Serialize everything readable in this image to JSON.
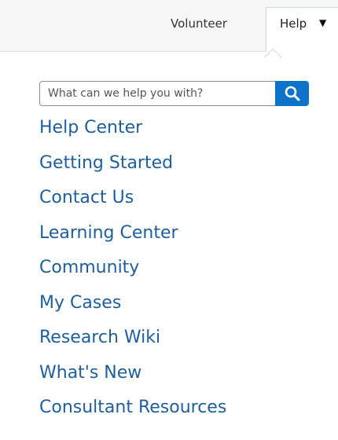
{
  "topnav": {
    "volunteer_label": "Volunteer",
    "help_label": "Help",
    "help_caret": "▼"
  },
  "search": {
    "placeholder": "What can we help you with?",
    "button_icon": "search-icon"
  },
  "menu": {
    "items": [
      "Help Center",
      "Getting Started",
      "Contact Us",
      "Learning Center",
      "Community",
      "My Cases",
      "Research Wiki",
      "What's New",
      "Consultant Resources"
    ]
  },
  "colors": {
    "link": "#1f5e9c",
    "search_button": "#0c73c8",
    "topbar_background": "#f6f6f6"
  }
}
